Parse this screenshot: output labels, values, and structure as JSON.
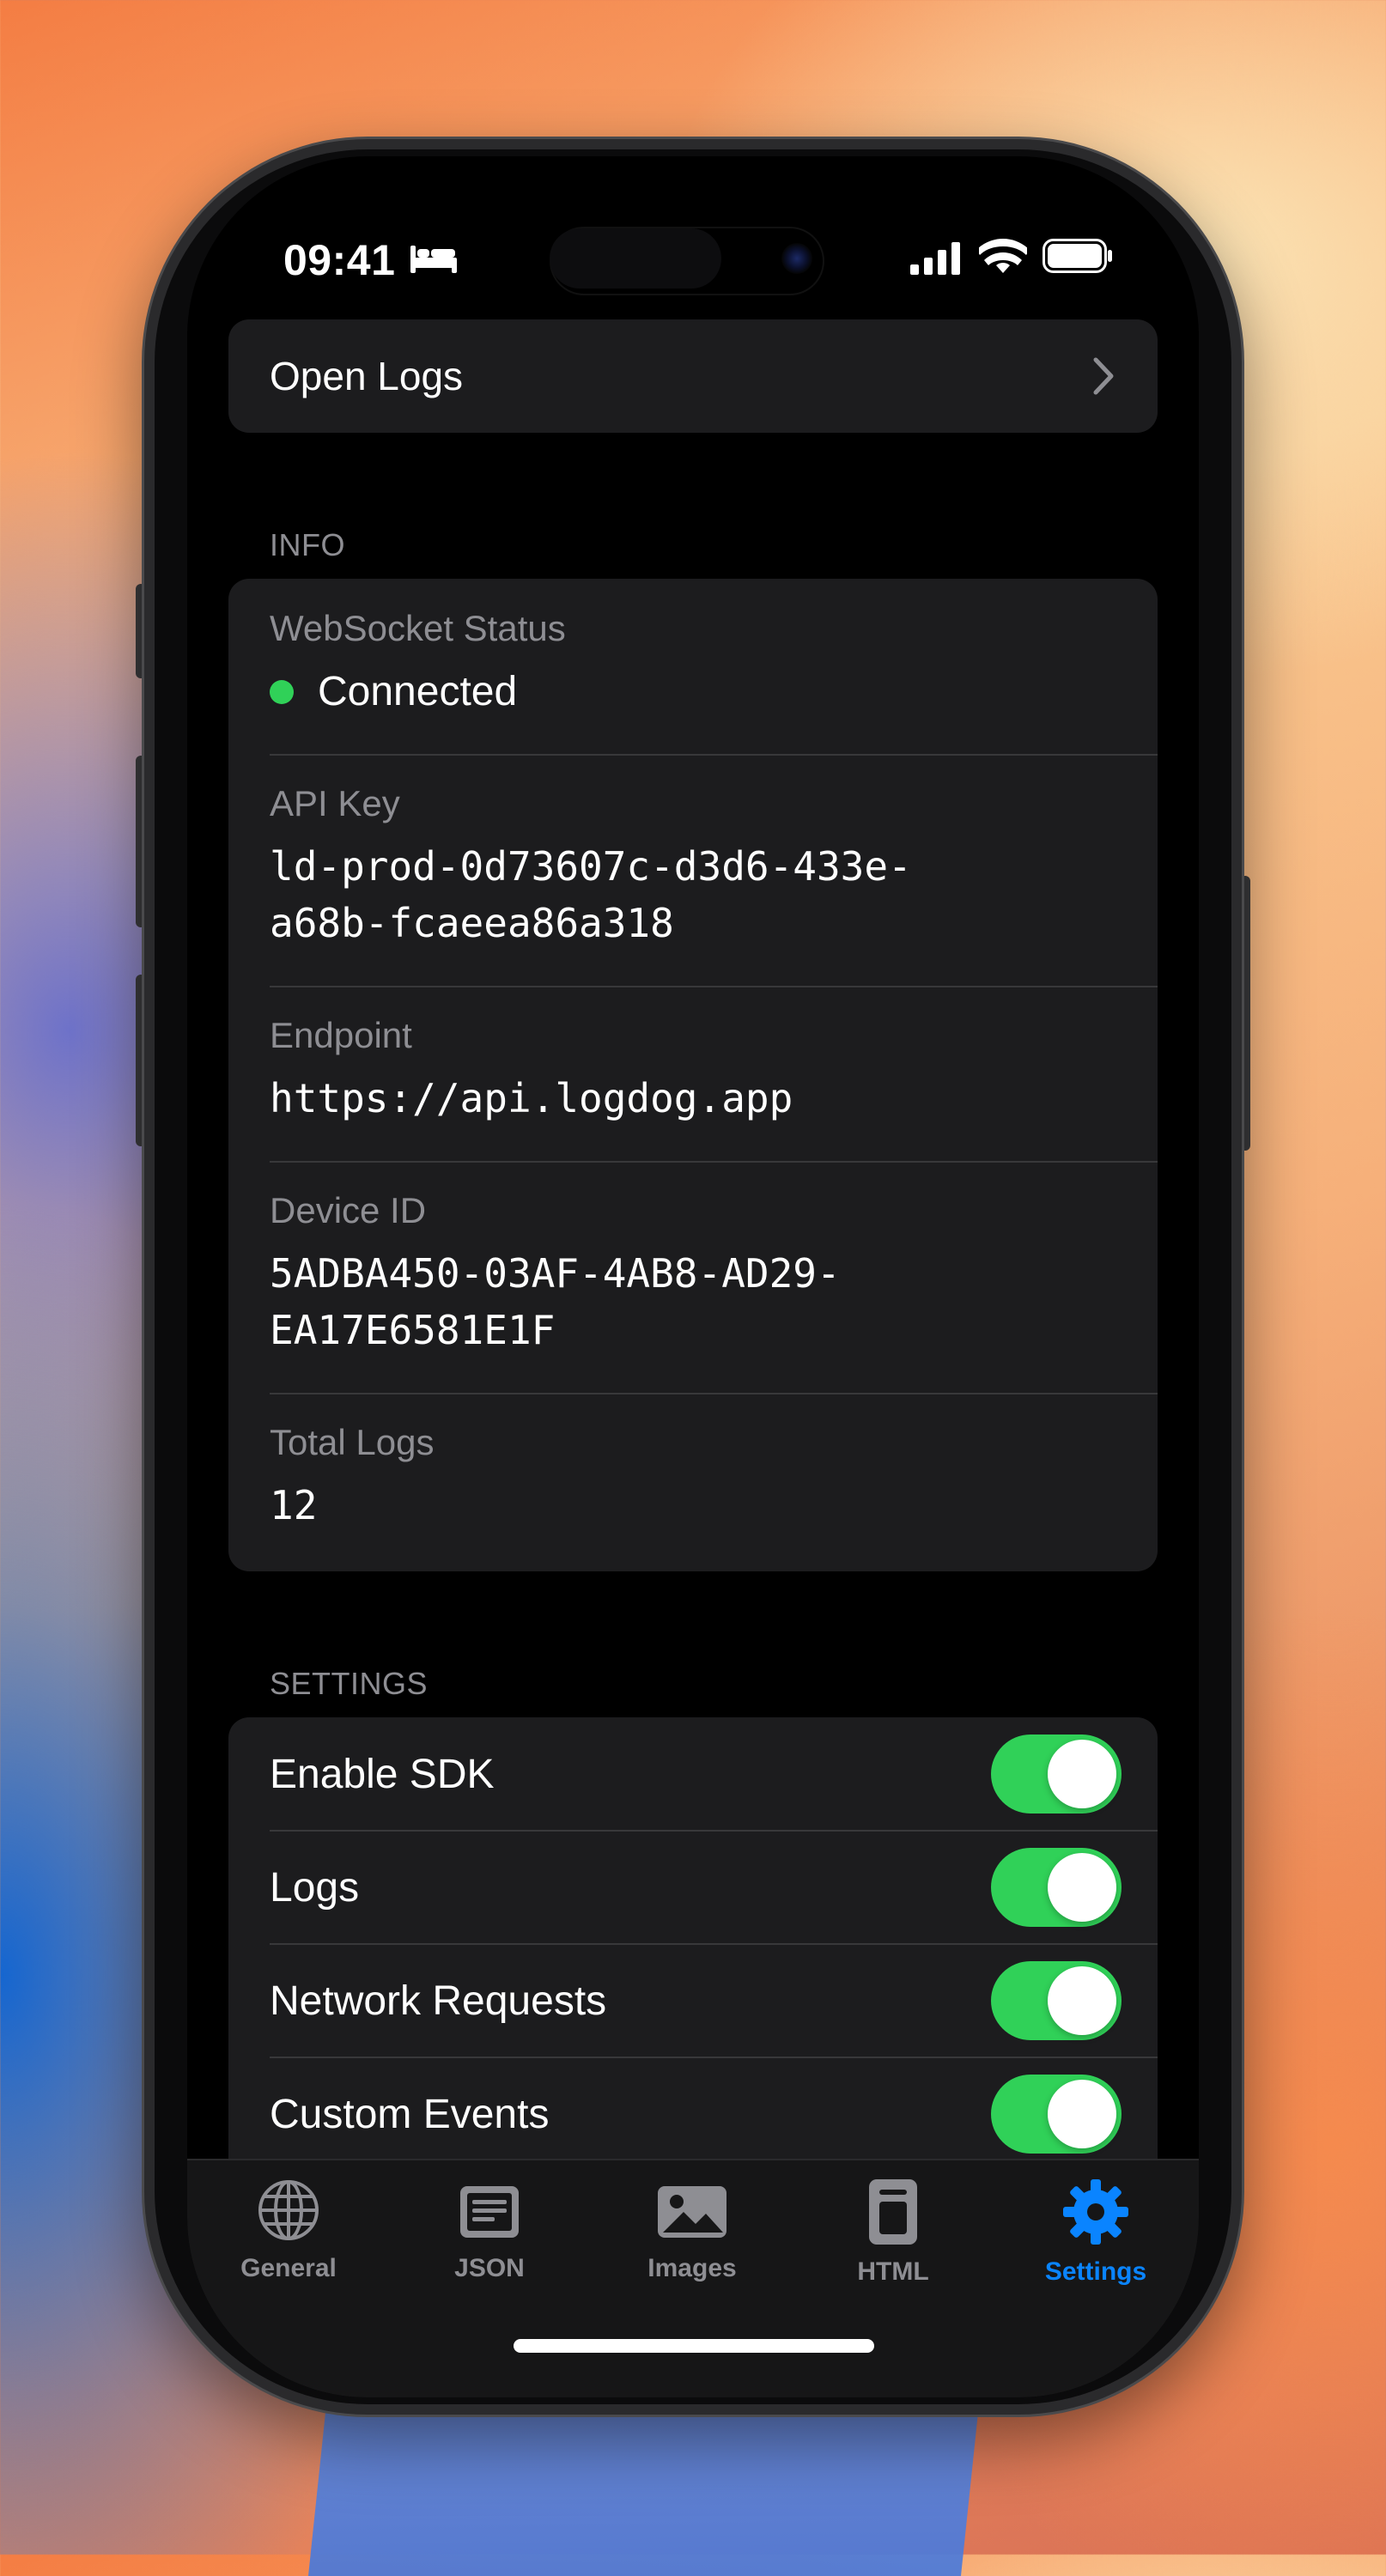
{
  "status_bar": {
    "time": "09:41",
    "icons": [
      "bed-icon",
      "signal-icon",
      "wifi-icon",
      "battery-icon"
    ]
  },
  "open_logs": {
    "label": "Open Logs"
  },
  "info": {
    "header": "INFO",
    "websocket": {
      "label": "WebSocket Status",
      "value": "Connected",
      "status_color": "#30d158"
    },
    "api_key": {
      "label": "API Key",
      "value_line1": "ld-prod-0d73607c-d3d6-433e-",
      "value_line2": "a68b-fcaeea86a318"
    },
    "endpoint": {
      "label": "Endpoint",
      "value": "https://api.logdog.app"
    },
    "device_id": {
      "label": "Device ID",
      "value_line1": "5ADBA450-03AF-4AB8-AD29-",
      "value_line2": "EA17E6581E1F"
    },
    "total_logs": {
      "label": "Total Logs",
      "value": "12"
    }
  },
  "settings": {
    "header": "SETTINGS",
    "toggles": [
      {
        "label": "Enable SDK",
        "on": true
      },
      {
        "label": "Logs",
        "on": true
      },
      {
        "label": "Network Requests",
        "on": true
      },
      {
        "label": "Custom Events",
        "on": true
      }
    ]
  },
  "tab_bar": {
    "tabs": [
      {
        "label": "General",
        "icon": "globe-icon",
        "active": false
      },
      {
        "label": "JSON",
        "icon": "json-document-icon",
        "active": false
      },
      {
        "label": "Images",
        "icon": "photo-icon",
        "active": false
      },
      {
        "label": "HTML",
        "icon": "html-document-icon",
        "active": false
      },
      {
        "label": "Settings",
        "icon": "gear-icon",
        "active": true
      }
    ],
    "active_color": "#0a84ff",
    "inactive_color": "#8e8e93"
  },
  "colors": {
    "toggle_on": "#30d158",
    "card_bg": "#1c1c1e"
  }
}
